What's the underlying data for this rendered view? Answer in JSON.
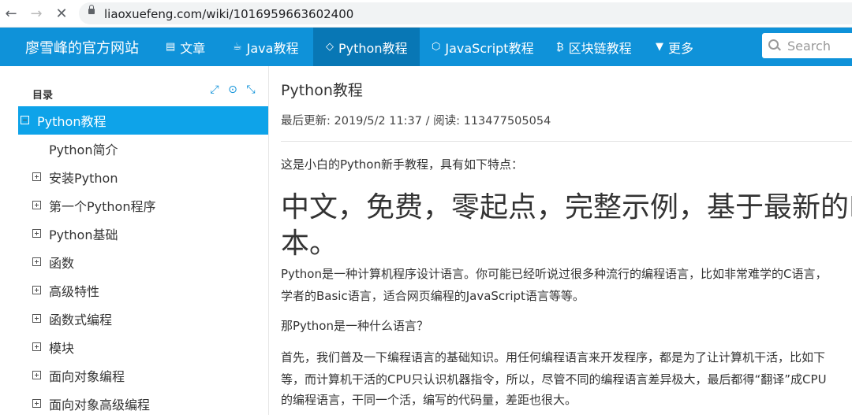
{
  "browser": {
    "url": "liaoxuefeng.com/wiki/1016959663602400"
  },
  "nav": {
    "brand": "廖雪峰的官方网站",
    "items": [
      {
        "icon": "newspaper-icon",
        "label": "文章"
      },
      {
        "icon": "coffee-icon",
        "label": "Java教程"
      },
      {
        "icon": "code-icon",
        "label": "Python教程",
        "active": true
      },
      {
        "icon": "cube-icon",
        "label": "JavaScript教程"
      },
      {
        "icon": "bitcoin-icon",
        "label": "区块链教程"
      },
      {
        "icon": "chevron-down-icon",
        "label": "更多"
      }
    ],
    "search_placeholder": "Search"
  },
  "sidebar": {
    "title": "目录",
    "tools": [
      "expand-icon",
      "target-icon",
      "compress-icon"
    ],
    "items": [
      {
        "label": "Python教程",
        "state": "expanded",
        "active": true
      },
      {
        "label": "Python简介",
        "state": "leaf"
      },
      {
        "label": "安装Python",
        "state": "collapsed"
      },
      {
        "label": "第一个Python程序",
        "state": "collapsed"
      },
      {
        "label": "Python基础",
        "state": "collapsed"
      },
      {
        "label": "函数",
        "state": "collapsed"
      },
      {
        "label": "高级特性",
        "state": "collapsed"
      },
      {
        "label": "函数式编程",
        "state": "collapsed"
      },
      {
        "label": "模块",
        "state": "collapsed"
      },
      {
        "label": "面向对象编程",
        "state": "collapsed"
      },
      {
        "label": "面向对象高级编程",
        "state": "collapsed"
      }
    ]
  },
  "article": {
    "title": "Python教程",
    "meta": "最后更新: 2019/5/2 11:37 / 阅读: 113477505054",
    "intro": "这是小白的Python新手教程，具有如下特点：",
    "headline_line1": "中文，免费，零起点，完整示例，基于最新的P",
    "headline_line2": "本。",
    "para1_line1": "Python是一种计算机程序设计语言。你可能已经听说过很多种流行的编程语言，比如非常难学的C语言，",
    "para1_line2": "学者的Basic语言，适合网页编程的JavaScript语言等等。",
    "para2": "那Python是一种什么语言？",
    "para3_line1": "首先，我们普及一下编程语言的基础知识。用任何编程语言来开发程序，都是为了让计算机干活，比如下",
    "para3_line2": "等，而计算机干活的CPU只认识机器指令，所以，尽管不同的编程语言差异极大，最后都得“翻译”成CPU",
    "para3_line3": "的编程语言，干同一个活，编写的代码量，差距也很大。"
  }
}
